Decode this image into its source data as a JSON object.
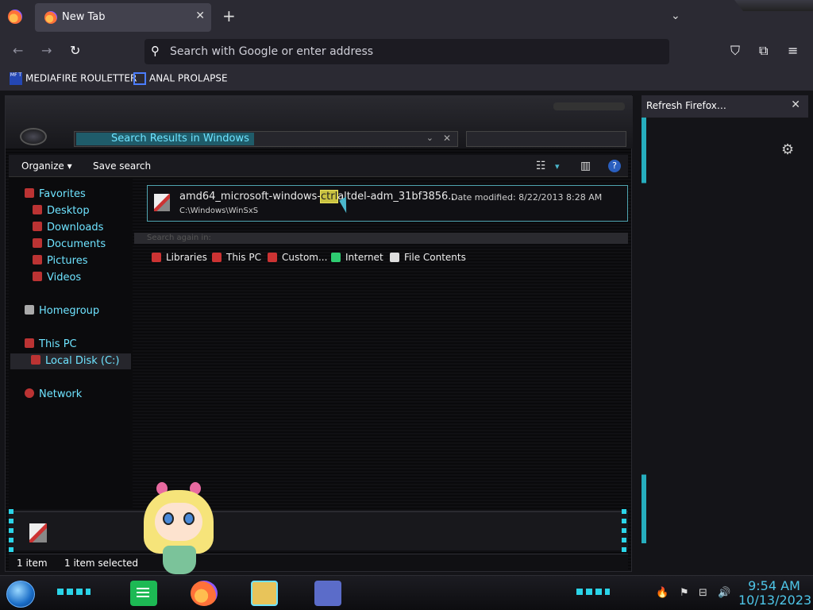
{
  "browser": {
    "tab_title": "New Tab",
    "tab_close": "✕",
    "new_tab": "+",
    "list_tabs": "⌄",
    "nav": {
      "back": "←",
      "forward": "→",
      "reload": "↻"
    },
    "search_icon": "⚲",
    "address_placeholder": "Search with Google or enter address",
    "icons": {
      "pocket": "⛉",
      "extensions": "⧉",
      "menu": "≡"
    },
    "bookmarks": [
      {
        "label": "MEDIAFIRE ROULETTER",
        "icon_text": "MF T"
      },
      {
        "label": "ANAL PROLAPSE",
        "icon_text": ""
      }
    ],
    "notification": {
      "text": "Refresh Firefox…",
      "close": "✕"
    },
    "settings_icon": "⚙"
  },
  "explorer": {
    "breadcrumb": "Search Results in Windows",
    "addr_dropdown": "⌄",
    "addr_clear": "✕",
    "commands": {
      "organize": "Organize ▾",
      "save_search": "Save search"
    },
    "view_icons": {
      "views": "☷",
      "views_dd": "▾",
      "preview": "▥",
      "help": "?"
    },
    "nav_pane": [
      {
        "label": "Favorites",
        "level": 0
      },
      {
        "label": "Desktop",
        "level": 1
      },
      {
        "label": "Downloads",
        "level": 1
      },
      {
        "label": "Documents",
        "level": 1
      },
      {
        "label": "Pictures",
        "level": 1
      },
      {
        "label": "Videos",
        "level": 1
      },
      {
        "label": "Homegroup",
        "level": 0
      },
      {
        "label": "This PC",
        "level": 0
      },
      {
        "label": "Local Disk (C:)",
        "level": 1,
        "selected": true
      },
      {
        "label": "Network",
        "level": 0
      }
    ],
    "result": {
      "name_prefix": "amd64_microsoft-windows-",
      "name_highlight": "ctrl",
      "name_suffix": "altdel-adm_31bf3856...",
      "path": "C:\\Windows\\WinSxS",
      "date_modified": "Date modified: 8/22/2013 8:28 AM"
    },
    "search_again_label": "Search again in:",
    "search_again": [
      "Libraries",
      "This PC",
      "Custom...",
      "Internet",
      "File Contents"
    ],
    "status": {
      "count": "1 item",
      "selected": "1 item selected"
    }
  },
  "taskbar": {
    "time": "9:54 AM",
    "date": "10/13/2023",
    "tray": [
      "🔥",
      "⚑",
      "⊟",
      "🔊"
    ]
  }
}
